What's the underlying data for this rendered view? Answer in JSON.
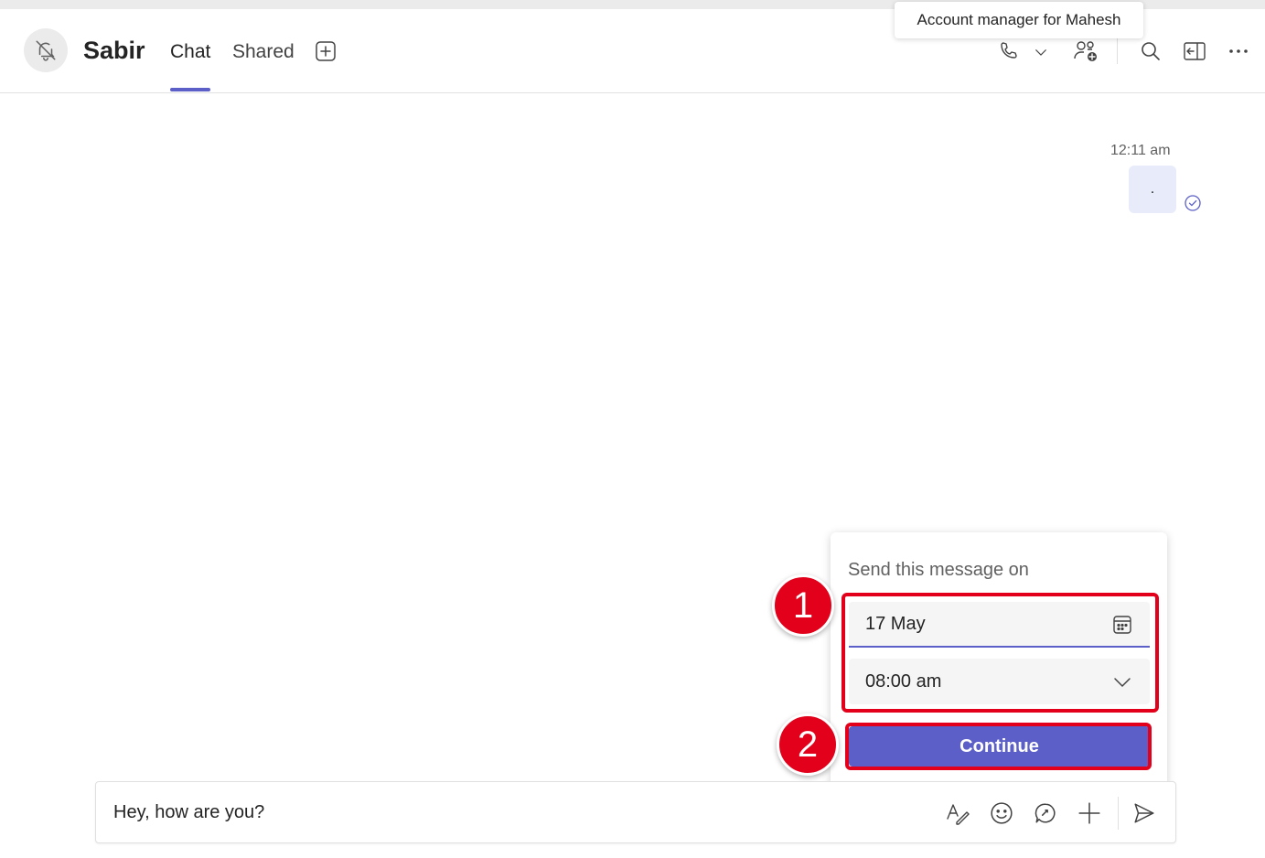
{
  "header": {
    "contact_name": "Sabir",
    "tabs": [
      {
        "label": "Chat",
        "active": true
      },
      {
        "label": "Shared",
        "active": false
      }
    ],
    "add_tab_icon": "add-square-icon",
    "actions": [
      "call-icon",
      "chevron-down-icon",
      "add-people-icon",
      "search-icon",
      "popout-icon",
      "more-icon"
    ],
    "tooltip": "Account manager for Mahesh"
  },
  "messages": [
    {
      "time": "12:11 am",
      "text": ".",
      "status_icon": "read-check-icon"
    }
  ],
  "schedule_popup": {
    "title": "Send this message on",
    "date_value": "17 May",
    "date_icon": "calendar-icon",
    "time_value": "08:00 am",
    "time_icon": "chevron-down-icon",
    "continue_label": "Continue"
  },
  "annotations": {
    "step1": "1",
    "step2": "2",
    "highlight_color": "#e2001a"
  },
  "composer": {
    "text": "Hey, how are you?",
    "actions": [
      "format-icon",
      "emoji-icon",
      "loop-icon",
      "attach-plus-icon",
      "send-icon"
    ]
  },
  "colors": {
    "accent": "#5b5fc7",
    "bubble": "#e8ebfa"
  }
}
